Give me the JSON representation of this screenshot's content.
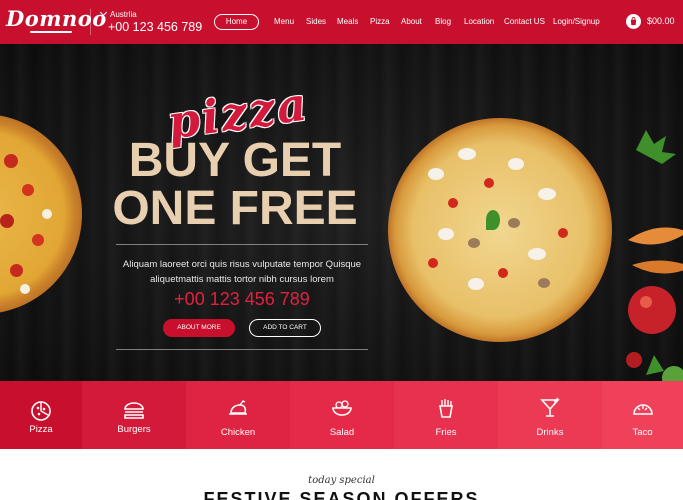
{
  "brand": {
    "logo_text": "Domnoo"
  },
  "header": {
    "country": "Austrlia",
    "phone": "+00 123 456 789",
    "nav": [
      {
        "label": "Home",
        "active": true
      },
      {
        "label": "Menu"
      },
      {
        "label": "Sides"
      },
      {
        "label": "Meals"
      },
      {
        "label": "Pizza"
      },
      {
        "label": "About"
      },
      {
        "label": "Blog"
      },
      {
        "label": "Location"
      },
      {
        "label": "Contact US"
      },
      {
        "label": "Login/Signup"
      }
    ],
    "cart_total": "$00.00",
    "cart_icon": "shopping-bag-icon"
  },
  "hero": {
    "script_title": "pizza",
    "headline_line1": "BUY GET",
    "headline_line2": "ONE FREE",
    "description_line1": "Aliquam laoreet orci quis risus vulputate tempor Quisque",
    "description_line2": "aliquetmattis mattis tortor nibh cursus lorem",
    "phone": "+00 123 456 789",
    "button_primary": "ABOUT MORE",
    "button_secondary": "ADD TO CART"
  },
  "categories": [
    {
      "label": "Pizza",
      "icon": "pizza-icon",
      "color": "#c8102e"
    },
    {
      "label": "Burgers",
      "icon": "burger-icon",
      "color": "#d41a3a"
    },
    {
      "label": "Chicken",
      "icon": "chicken-icon",
      "color": "#de2442"
    },
    {
      "label": "Salad",
      "icon": "salad-bowl-icon",
      "color": "#e42a48"
    },
    {
      "label": "Fries",
      "icon": "fries-icon",
      "color": "#e8314e"
    },
    {
      "label": "Drinks",
      "icon": "cocktail-icon",
      "color": "#ec3954"
    },
    {
      "label": "Taco",
      "icon": "taco-icon",
      "color": "#f0415b"
    }
  ],
  "special": {
    "script": "today special",
    "title": "FESTIVE SEASON OFFERS"
  },
  "colors": {
    "brand_red": "#c8102e",
    "headline_cream": "#e8cfb0",
    "accent_red": "#e0213f"
  }
}
